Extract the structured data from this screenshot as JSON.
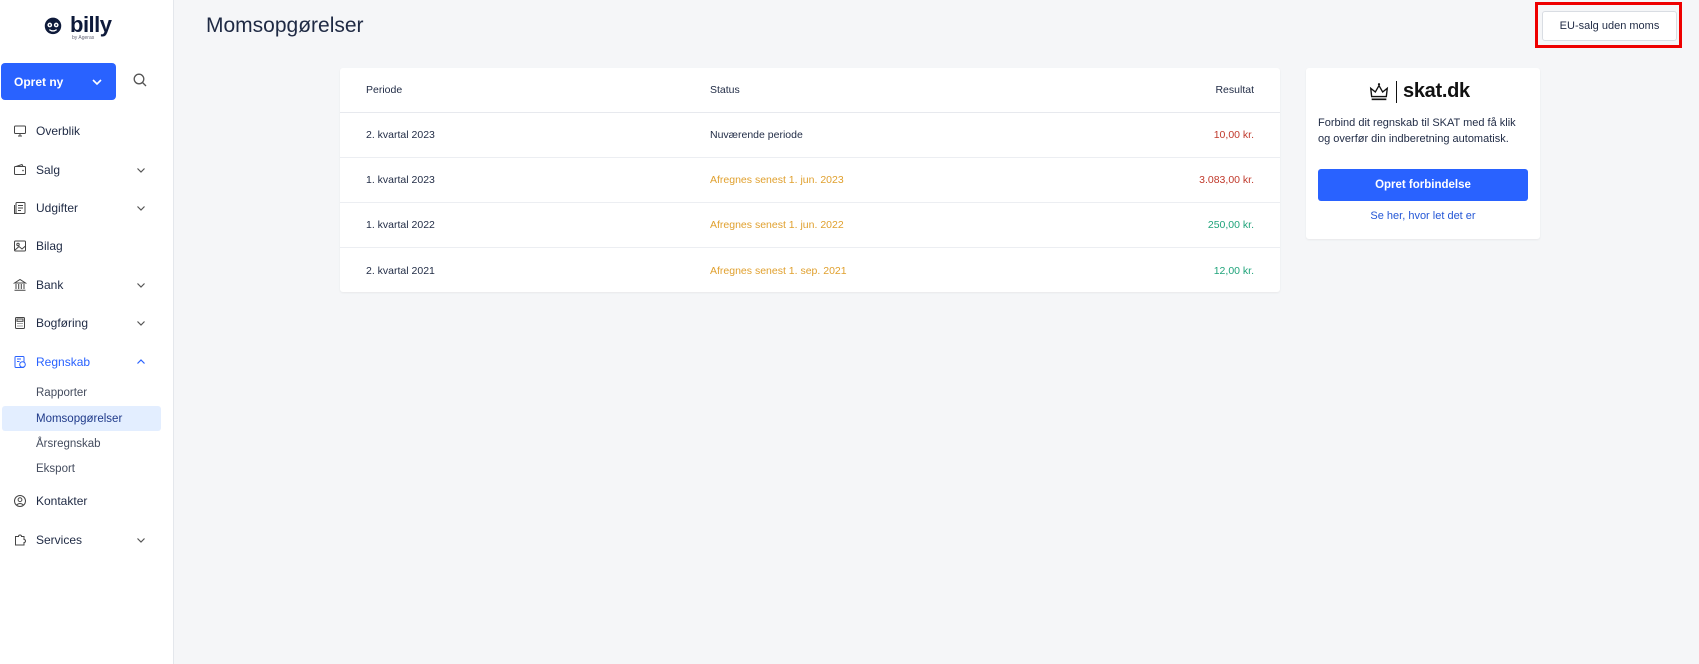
{
  "brand": {
    "name": "billy",
    "sub": "by Ageras"
  },
  "sidebar": {
    "create_label": "Opret ny",
    "items": [
      {
        "label": "Overblik",
        "icon": "monitor-icon",
        "chevron": false
      },
      {
        "label": "Salg",
        "icon": "wallet-icon",
        "chevron": true
      },
      {
        "label": "Udgifter",
        "icon": "receipt-icon",
        "chevron": true
      },
      {
        "label": "Bilag",
        "icon": "image-icon",
        "chevron": false
      },
      {
        "label": "Bank",
        "icon": "bank-icon",
        "chevron": true
      },
      {
        "label": "Bogføring",
        "icon": "calculator-icon",
        "chevron": true
      },
      {
        "label": "Regnskab",
        "icon": "accounting-icon",
        "chevron": true,
        "expanded": true
      }
    ],
    "sub_items": [
      "Rapporter",
      "Momsopgørelser",
      "Årsregnskab",
      "Eksport"
    ],
    "bottom_items": [
      {
        "label": "Kontakter",
        "icon": "contact-icon",
        "chevron": false
      },
      {
        "label": "Services",
        "icon": "puzzle-icon",
        "chevron": true
      }
    ]
  },
  "header": {
    "title": "Momsopgørelser",
    "eu_button": "EU-salg uden moms"
  },
  "table": {
    "columns": [
      "Periode",
      "Status",
      "Resultat"
    ],
    "rows": [
      {
        "period": "2. kvartal 2023",
        "status": "Nuværende periode",
        "result": "10,00 kr."
      },
      {
        "period": "1. kvartal 2023",
        "status": "Afregnes senest 1. jun. 2023",
        "result": "3.083,00 kr."
      },
      {
        "period": "1. kvartal 2022",
        "status": "Afregnes senest 1. jun. 2022",
        "result": "250,00 kr."
      },
      {
        "period": "2. kvartal 2021",
        "status": "Afregnes senest 1. sep. 2021",
        "result": "12,00 kr."
      }
    ]
  },
  "skat": {
    "logo_text": "skat.dk",
    "description": "Forbind dit regnskab til SKAT med få klik og overfør din indberetning automatisk.",
    "button": "Opret forbindelse",
    "link": "Se her, hvor let det er"
  },
  "colors": {
    "primary": "#2962ff",
    "due": "#e0a02e",
    "negative": "#c0392b",
    "positive": "#1fa37a",
    "highlight": "#ee0000"
  }
}
